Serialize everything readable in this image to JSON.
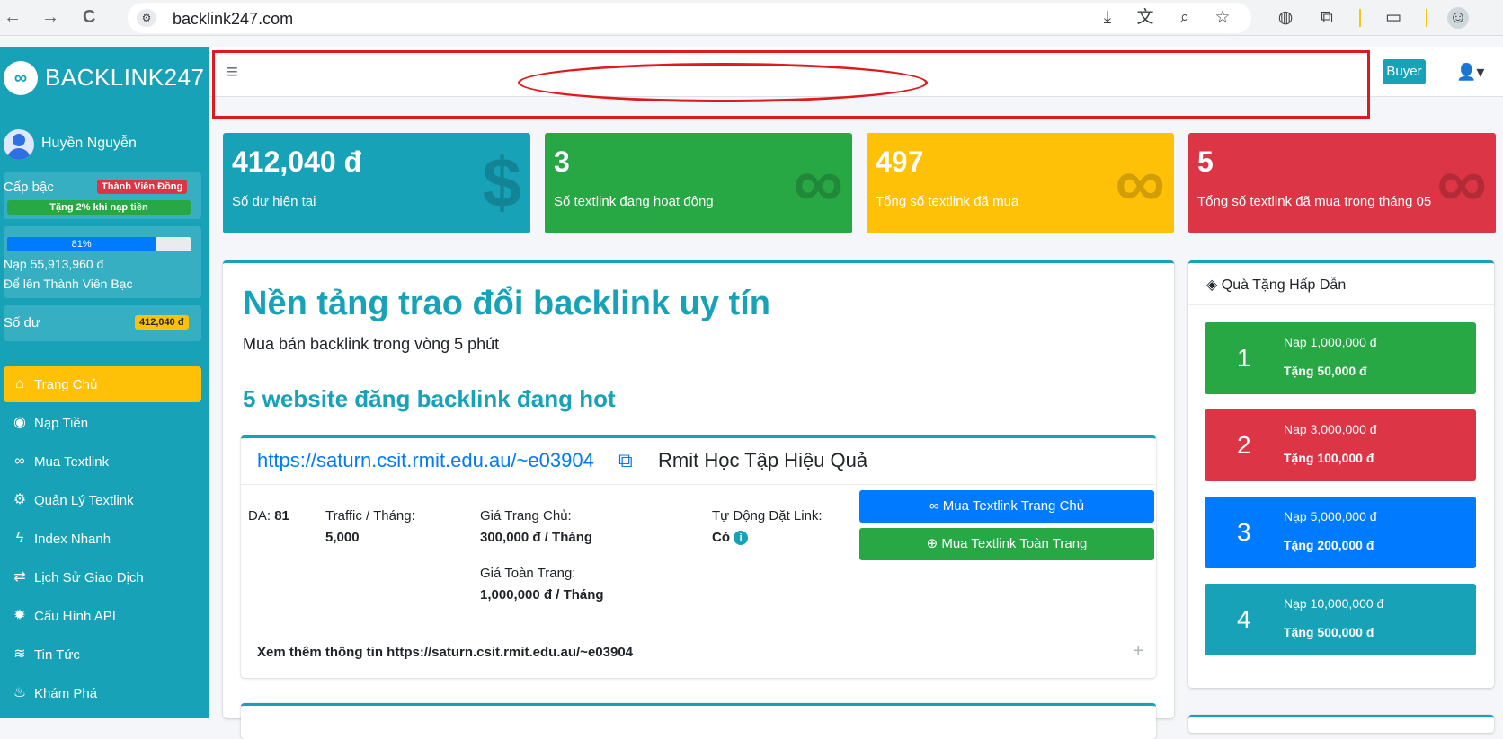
{
  "browser": {
    "url": "backlink247.com",
    "back_icon": "←",
    "forward_icon": "→",
    "reload_icon": "C"
  },
  "brand": {
    "name": "BACKLINK247"
  },
  "user": {
    "name": "Huyền Nguyễn",
    "rank_label": "Cấp bậc",
    "rank_badge": "Thành Viên Đồng",
    "bonus_badge": "Tặng 2% khi nạp tiền",
    "progress_percent": 81,
    "progress_text": "81%",
    "deposit_line": "Nạp 55,913,960 đ",
    "next_rank_line": "Để lên Thành Viên Bạc",
    "balance_label": "Số dư",
    "balance_badge": "412,040 đ"
  },
  "menu": [
    {
      "label": "Trang Chủ",
      "icon": "home-icon",
      "glyph": "⌂",
      "active": true
    },
    {
      "label": "Nạp Tiền",
      "icon": "piggy-bank-icon",
      "glyph": "◉",
      "active": false
    },
    {
      "label": "Mua Textlink",
      "icon": "link-icon",
      "glyph": "∞",
      "active": false
    },
    {
      "label": "Quản Lý Textlink",
      "icon": "sitemap-icon",
      "glyph": "⚙",
      "active": false
    },
    {
      "label": "Index Nhanh",
      "icon": "bolt-icon",
      "glyph": "ϟ",
      "active": false
    },
    {
      "label": "Lịch Sử Giao Dịch",
      "icon": "exchange-icon",
      "glyph": "⇄",
      "active": false
    },
    {
      "label": "Cấu Hình API",
      "icon": "cog-icon",
      "glyph": "✹",
      "active": false
    },
    {
      "label": "Tin Tức",
      "icon": "rss-icon",
      "glyph": "≋",
      "active": false
    },
    {
      "label": "Khám Phá",
      "icon": "fire-icon",
      "glyph": "♨",
      "active": false
    }
  ],
  "topnav": {
    "buyer_label": "Buyer"
  },
  "stats": [
    {
      "value": "412,040 đ",
      "label": "Số dư hiện tại",
      "color": "#17a2b8",
      "icon": "dollar-icon",
      "glyph": "$"
    },
    {
      "value": "3",
      "label": "Số textlink đang hoạt động",
      "color": "#28a745",
      "icon": "link-icon",
      "glyph": "∞"
    },
    {
      "value": "497",
      "label": "Tổng số textlink đã mua",
      "color": "#ffc107",
      "icon": "link-icon",
      "glyph": "∞"
    },
    {
      "value": "5",
      "label": "Tổng số textlink đã mua trong tháng 05",
      "color": "#dc3545",
      "icon": "link-icon",
      "glyph": "∞"
    }
  ],
  "main": {
    "title": "Nền tảng trao đổi backlink uy tín",
    "subtitle": "Mua bán backlink trong vòng 5 phút",
    "hot_title": "5 website đăng backlink đang hot"
  },
  "site": {
    "url": "https://saturn.csit.rmit.edu.au/~e03904",
    "name": "Rmit Học Tập Hiệu Quả",
    "da_label": "DA:",
    "da_value": "81",
    "traffic_label": "Traffic / Tháng:",
    "traffic_value": "5,000",
    "home_price_label": "Giá Trang Chủ:",
    "home_price_value": "300,000 đ / Tháng",
    "full_price_label": "Giá Toàn Trang:",
    "full_price_value": "1,000,000 đ / Tháng",
    "auto_label": "Tự Động Đặt Link:",
    "auto_value": "Có",
    "btn_home": "Mua Textlink Trang Chủ",
    "btn_full": "Mua Textlink Toàn Trang",
    "more_text": "Xem thêm thông tin https://saturn.csit.rmit.edu.au/~e03904"
  },
  "gifts": {
    "title": "Quà Tặng Hấp Dẫn",
    "items": [
      {
        "num": "1",
        "line1": "Nạp 1,000,000 đ",
        "line2": "Tặng 50,000 đ",
        "color": "#28a745"
      },
      {
        "num": "2",
        "line1": "Nạp 3,000,000 đ",
        "line2": "Tặng 100,000 đ",
        "color": "#dc3545"
      },
      {
        "num": "3",
        "line1": "Nạp 5,000,000 đ",
        "line2": "Tặng 200,000 đ",
        "color": "#007bff"
      },
      {
        "num": "4",
        "line1": "Nạp 10,000,000 đ",
        "line2": "Tặng 500,000 đ",
        "color": "#17a2b8"
      }
    ]
  }
}
